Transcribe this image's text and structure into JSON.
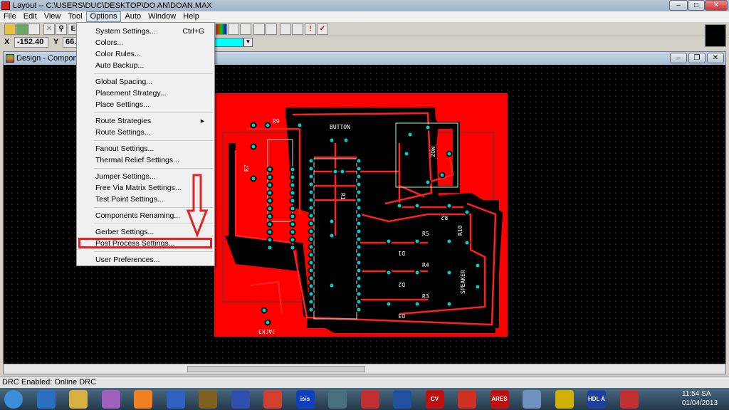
{
  "window": {
    "title": "Layout -- C:\\USERS\\DUC\\DESKTOP\\DO AN\\DOAN.MAX",
    "controls": [
      "minimize",
      "maximize",
      "close"
    ]
  },
  "menubar": [
    "File",
    "Edit",
    "View",
    "Tool",
    "Options",
    "Auto",
    "Window",
    "Help"
  ],
  "coords": {
    "x_label": "X",
    "x_value": "-152.40",
    "y_label": "Y",
    "y_value": "66.0"
  },
  "layer_color": "#00ffff",
  "child": {
    "title": "Design - Component"
  },
  "options_menu": {
    "items": [
      {
        "label": "System Settings...",
        "shortcut": "Ctrl+G"
      },
      {
        "label": "Colors..."
      },
      {
        "label": "Color Rules..."
      },
      {
        "label": "Auto Backup..."
      },
      {
        "label": "Global Spacing..."
      },
      {
        "label": "Placement Strategy..."
      },
      {
        "label": "Place Settings..."
      },
      {
        "label": "Route Strategies",
        "submenu": true
      },
      {
        "label": "Route Settings..."
      },
      {
        "label": "Fanout Settings..."
      },
      {
        "label": "Thermal Relief Settings..."
      },
      {
        "label": "Jumper Settings..."
      },
      {
        "label": "Free Via Matrix Settings..."
      },
      {
        "label": "Test Point Settings..."
      },
      {
        "label": "Components Renaming..."
      },
      {
        "label": "Gerber Settings..."
      },
      {
        "label": "Post Process Settings...",
        "highlighted": true
      },
      {
        "label": "User Preferences..."
      }
    ]
  },
  "pcb": {
    "labels": [
      "R9",
      "BUTTON",
      "MOZ",
      "R7",
      "R1",
      "R2",
      "R5",
      "R4",
      "R3",
      "R10",
      "D1",
      "D2",
      "D3",
      "SPEAKER",
      "JACK3"
    ]
  },
  "status": "DRC Enabled: Online DRC",
  "taskbar": {
    "apps": [
      "start",
      "ie",
      "explorer",
      "messenger",
      "vlc",
      "app",
      "chip",
      "visio",
      "chrome",
      "isis",
      "app2",
      "layout",
      "word",
      "CV AVR",
      "ccleaner",
      "ARES",
      "calc",
      "tool",
      "HDL A",
      "layout2"
    ],
    "clock": "11:54 SA",
    "date": "01/04/2013"
  },
  "colors": {
    "accent": "#e0222a",
    "copper": "#ff0000",
    "pad": "#00cccc"
  }
}
